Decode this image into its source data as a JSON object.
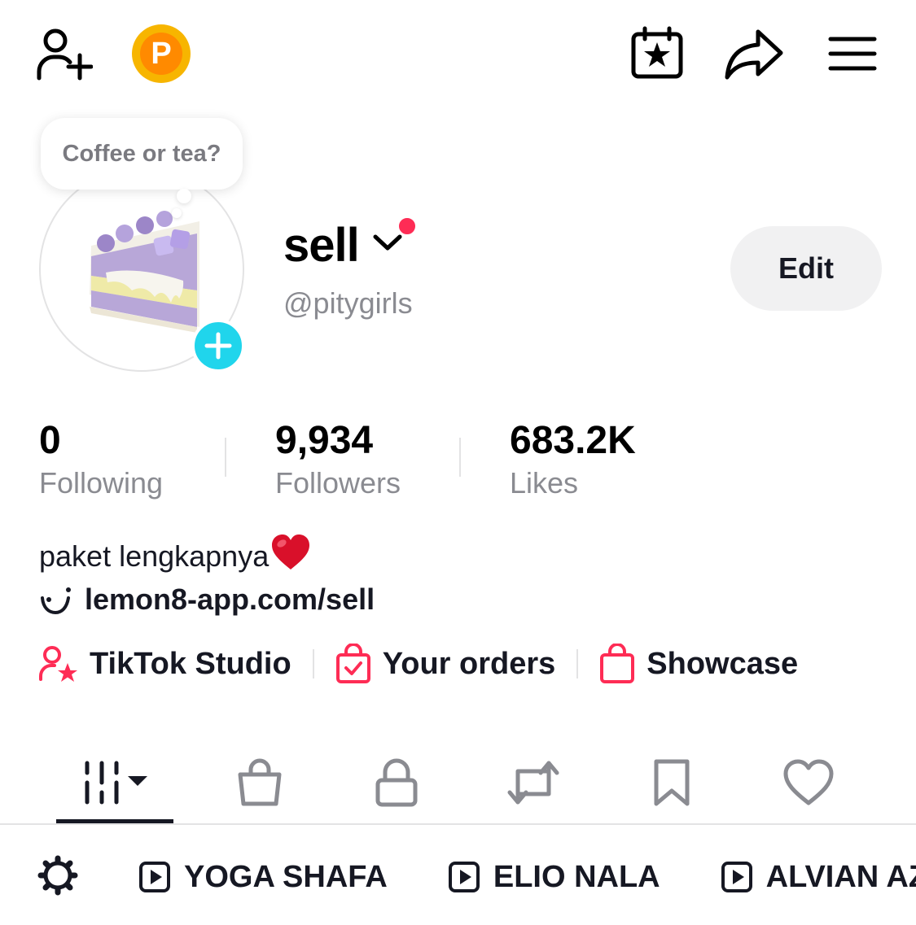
{
  "note": {
    "text": "Coffee or tea?"
  },
  "profile": {
    "display_name": "sell",
    "username": "@pitygirls",
    "edit_label": "Edit"
  },
  "stats": [
    {
      "value": "0",
      "label": "Following"
    },
    {
      "value": "9,934",
      "label": "Followers"
    },
    {
      "value": "683.2K",
      "label": "Likes"
    }
  ],
  "bio": {
    "text": "paket lengkapnya",
    "emoji": "❤️",
    "link": "lemon8-app.com/sell"
  },
  "tools": [
    {
      "label": "TikTok Studio",
      "icon": "creator-star-icon"
    },
    {
      "label": "Your orders",
      "icon": "orders-bag-icon"
    },
    {
      "label": "Showcase",
      "icon": "showcase-bag-icon"
    }
  ],
  "tabs": [
    {
      "name": "videos-grid",
      "icon": "grid-icon",
      "active": true
    },
    {
      "name": "shop",
      "icon": "shopping-bag-icon"
    },
    {
      "name": "private",
      "icon": "lock-icon"
    },
    {
      "name": "reposts",
      "icon": "repost-icon"
    },
    {
      "name": "favorites",
      "icon": "bookmark-icon"
    },
    {
      "name": "liked",
      "icon": "heart-icon"
    }
  ],
  "playlists": [
    {
      "label": "YOGA SHAFA"
    },
    {
      "label": "ELIO NALA"
    },
    {
      "label": "ALVIAN AZ"
    }
  ],
  "topbar": {
    "coin_letter": "P"
  },
  "colors": {
    "accent_red": "#fe2c55",
    "cyan": "#20d5ec",
    "text": "#161823",
    "secondary": "#8a8b91"
  }
}
